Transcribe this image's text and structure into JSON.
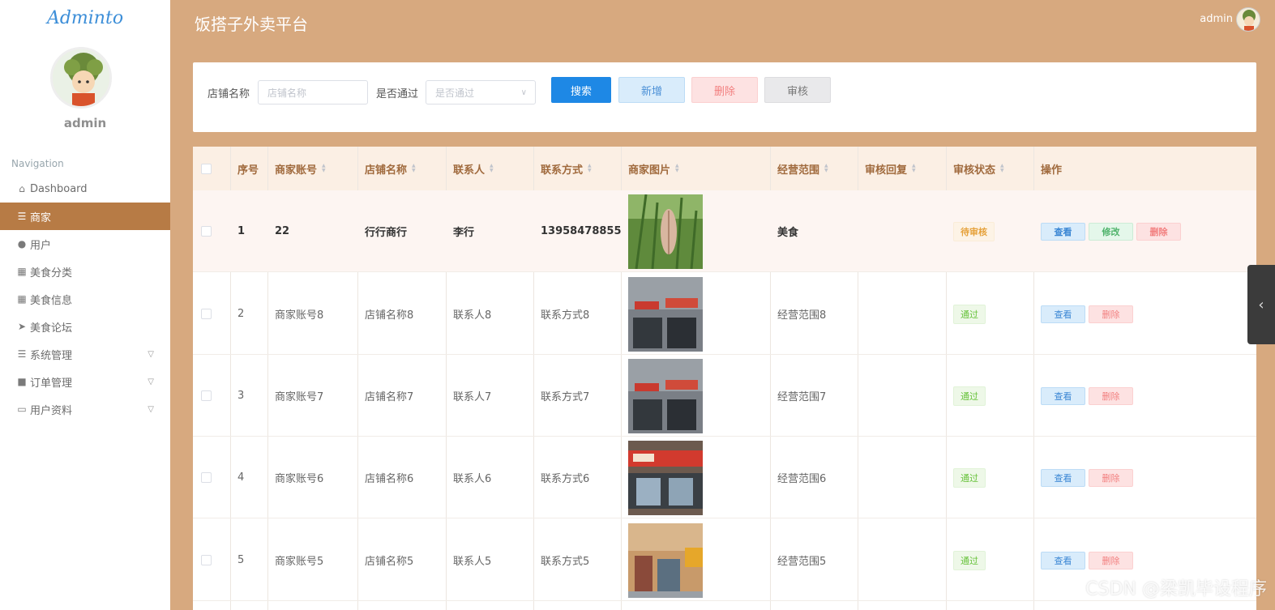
{
  "sidebar": {
    "logo": "Adminto",
    "username": "admin",
    "nav_title": "Navigation",
    "items": [
      {
        "label": "Dashboard",
        "icon": "home-icon"
      },
      {
        "label": "商家",
        "icon": "list-icon"
      },
      {
        "label": "用户",
        "icon": "user-icon"
      },
      {
        "label": "美食分类",
        "icon": "grid-icon"
      },
      {
        "label": "美食信息",
        "icon": "grid-icon"
      },
      {
        "label": "美食论坛",
        "icon": "send-icon"
      },
      {
        "label": "系统管理",
        "icon": "list-icon"
      },
      {
        "label": "订单管理",
        "icon": "chat-icon"
      },
      {
        "label": "用户资料",
        "icon": "card-icon"
      }
    ]
  },
  "header": {
    "title": "饭搭子外卖平台",
    "user": "admin"
  },
  "search": {
    "shop_label": "店铺名称",
    "shop_placeholder": "店铺名称",
    "pass_label": "是否通过",
    "pass_placeholder": "是否通过",
    "search_btn": "搜索",
    "add_btn": "新增",
    "delete_btn": "删除",
    "audit_btn": "审核"
  },
  "table": {
    "columns": [
      "序号",
      "商家账号",
      "店铺名称",
      "联系人",
      "联系方式",
      "商家图片",
      "经营范围",
      "审核回复",
      "审核状态",
      "操作"
    ],
    "rows": [
      {
        "no": "1",
        "account": "22",
        "shop": "行行商行",
        "contact": "李行",
        "phone": "13958478855",
        "scope": "美食",
        "reply": "",
        "status": "待审核"
      },
      {
        "no": "2",
        "account": "商家账号8",
        "shop": "店铺名称8",
        "contact": "联系人8",
        "phone": "联系方式8",
        "scope": "经营范围8",
        "reply": "",
        "status": "通过"
      },
      {
        "no": "3",
        "account": "商家账号7",
        "shop": "店铺名称7",
        "contact": "联系人7",
        "phone": "联系方式7",
        "scope": "经营范围7",
        "reply": "",
        "status": "通过"
      },
      {
        "no": "4",
        "account": "商家账号6",
        "shop": "店铺名称6",
        "contact": "联系人6",
        "phone": "联系方式6",
        "scope": "经营范围6",
        "reply": "",
        "status": "通过"
      },
      {
        "no": "5",
        "account": "商家账号5",
        "shop": "店铺名称5",
        "contact": "联系人5",
        "phone": "联系方式5",
        "scope": "经营范围5",
        "reply": "",
        "status": "通过"
      }
    ],
    "actions": {
      "view": "查看",
      "edit": "修改",
      "delete": "删除"
    }
  },
  "watermark": "CSDN @梁凯毕设程序",
  "colors": {
    "accent": "#b77b45",
    "background": "#d7a97f",
    "primary": "#1e88e5"
  }
}
